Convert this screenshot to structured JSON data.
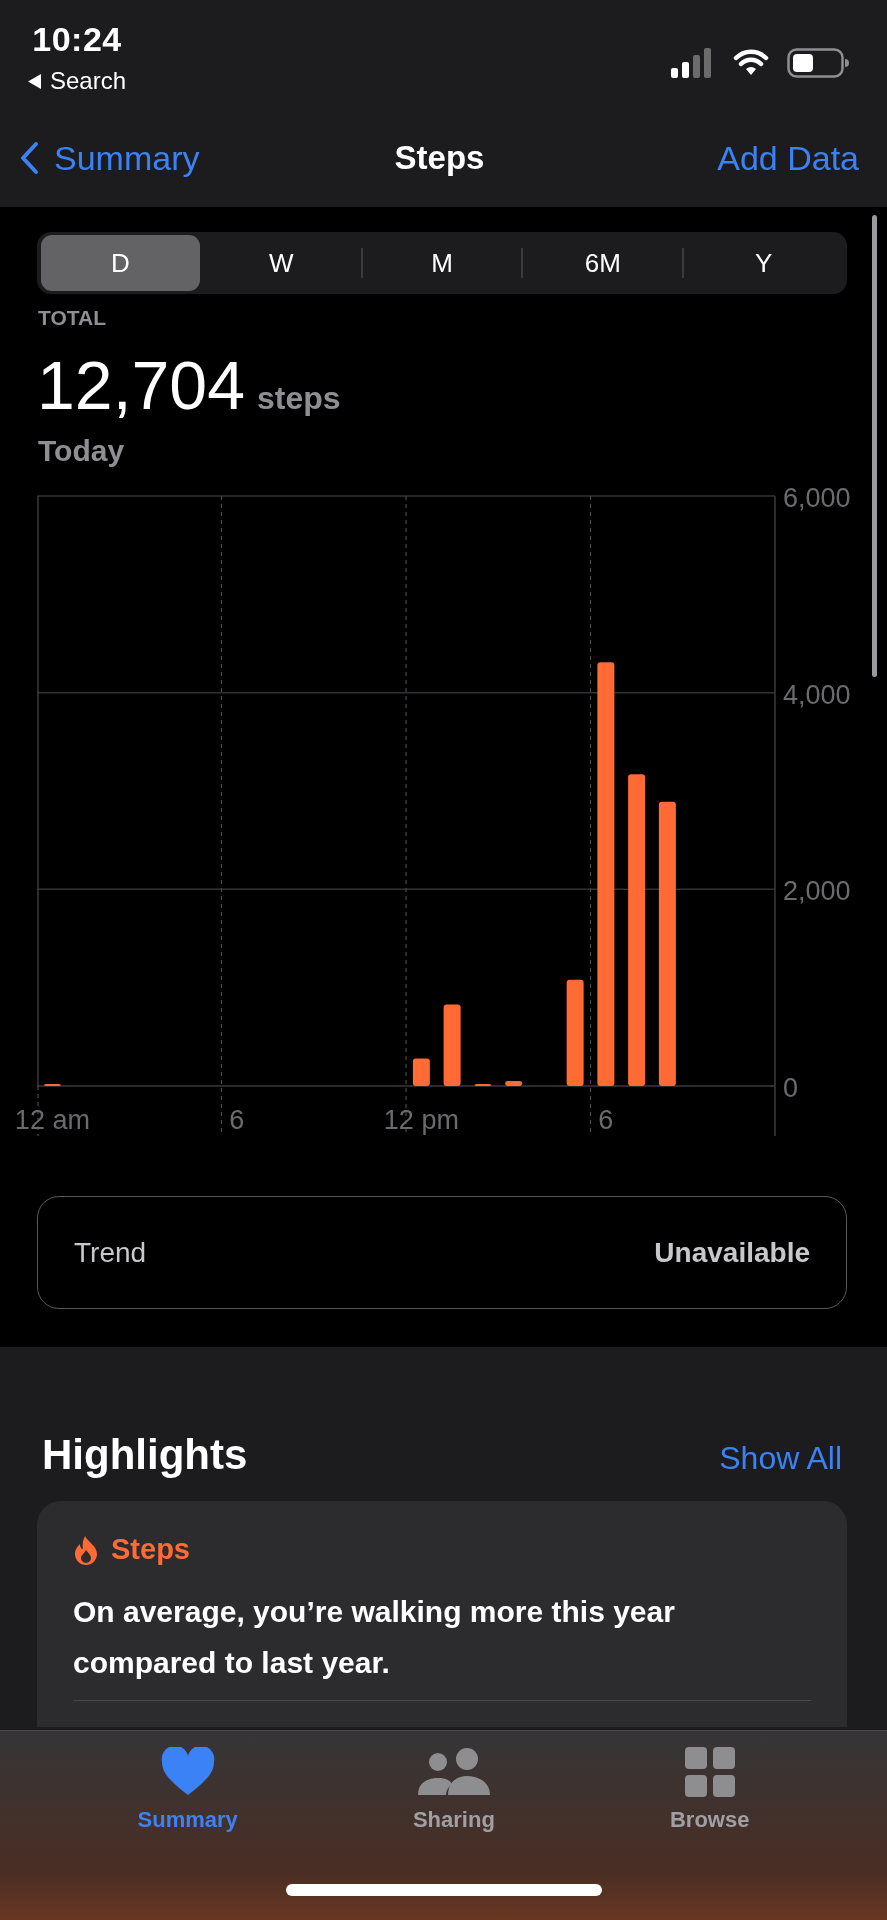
{
  "status_bar": {
    "time": "10:24",
    "back_label": "Search"
  },
  "nav": {
    "back": "Summary",
    "title": "Steps",
    "action": "Add Data"
  },
  "ranges": [
    {
      "label": "D",
      "selected": true
    },
    {
      "label": "W",
      "selected": false
    },
    {
      "label": "M",
      "selected": false
    },
    {
      "label": "6M",
      "selected": false
    },
    {
      "label": "Y",
      "selected": false
    }
  ],
  "summary": {
    "caption": "TOTAL",
    "value": "12,704",
    "unit": "steps",
    "period": "Today"
  },
  "chart_data": {
    "type": "bar",
    "categories": [
      "12 am",
      null,
      null,
      null,
      null,
      null,
      "6",
      null,
      null,
      null,
      null,
      null,
      "12 pm",
      null,
      null,
      null,
      null,
      null,
      "6",
      null,
      null,
      null,
      null,
      null
    ],
    "series": [
      {
        "color": "#ff6a35",
        "values": [
          20,
          0,
          0,
          0,
          0,
          0,
          0,
          0,
          0,
          0,
          0,
          0,
          280,
          830,
          20,
          50,
          0,
          1080,
          4310,
          3170,
          2890,
          0,
          0,
          0
        ]
      }
    ],
    "ylim": [
      0,
      6000
    ],
    "yticks": [
      {
        "value": 0,
        "label": "0"
      },
      {
        "value": 2000,
        "label": "2,000"
      },
      {
        "value": 4000,
        "label": "4,000"
      },
      {
        "value": 6000,
        "label": "6,000"
      }
    ],
    "orientation": "vertical"
  },
  "trend": {
    "label": "Trend",
    "value": "Unavailable"
  },
  "highlights": {
    "title": "Highlights",
    "action": "Show All",
    "card": {
      "category": "Steps",
      "text": "On average, you’re walking more this year compared to last year."
    }
  },
  "tab_bar": [
    {
      "label": "Summary",
      "selected": true
    },
    {
      "label": "Sharing",
      "selected": false
    },
    {
      "label": "Browse",
      "selected": false
    }
  ]
}
